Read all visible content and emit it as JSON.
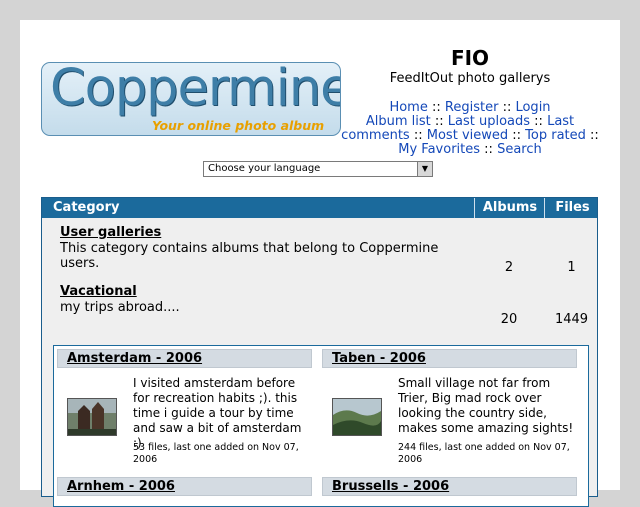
{
  "site": {
    "logo_main": "Coppermine",
    "logo_tagline": "Your online photo album",
    "title": "FIO",
    "description": "FeedItOut photo gallerys"
  },
  "nav": {
    "home": "Home",
    "register": "Register",
    "login": "Login",
    "album_list": "Album list",
    "last_uploads": "Last uploads",
    "last_comments": "Last comments",
    "most_viewed": "Most viewed",
    "top_rated": "Top rated",
    "my_favorites": "My Favorites",
    "search": "Search",
    "separator": "::"
  },
  "language": {
    "selected": "Choose your language"
  },
  "table": {
    "headers": {
      "category": "Category",
      "albums": "Albums",
      "files": "Files"
    },
    "categories": [
      {
        "name": "User galleries",
        "description": "This category contains albums that belong to Coppermine users.",
        "albums": "2",
        "files": "1"
      },
      {
        "name": "Vacational",
        "description": "my trips abroad....",
        "albums": "20",
        "files": "1449"
      }
    ]
  },
  "albums": [
    {
      "title": "Amsterdam - 2006",
      "description": "I visited amsterdam before for recreation habits ;). this time i guide a tour by time and saw a bit of amsterdam :)",
      "meta": "53 files, last one added on Nov 07, 2006",
      "thumb_colors": [
        "#6f7f6a",
        "#3b2a22",
        "#a7b5b9"
      ]
    },
    {
      "title": "Taben - 2006",
      "description": "Small village not far from Trier, Big mad rock over looking the country side, makes some amazing sights!",
      "meta": "244 files, last one added on Nov 07, 2006",
      "thumb_colors": [
        "#5d7a4d",
        "#2f4a2a",
        "#b7c7cf"
      ]
    },
    {
      "title": "Arnhem - 2006"
    },
    {
      "title": "Brussells - 2006"
    }
  ]
}
